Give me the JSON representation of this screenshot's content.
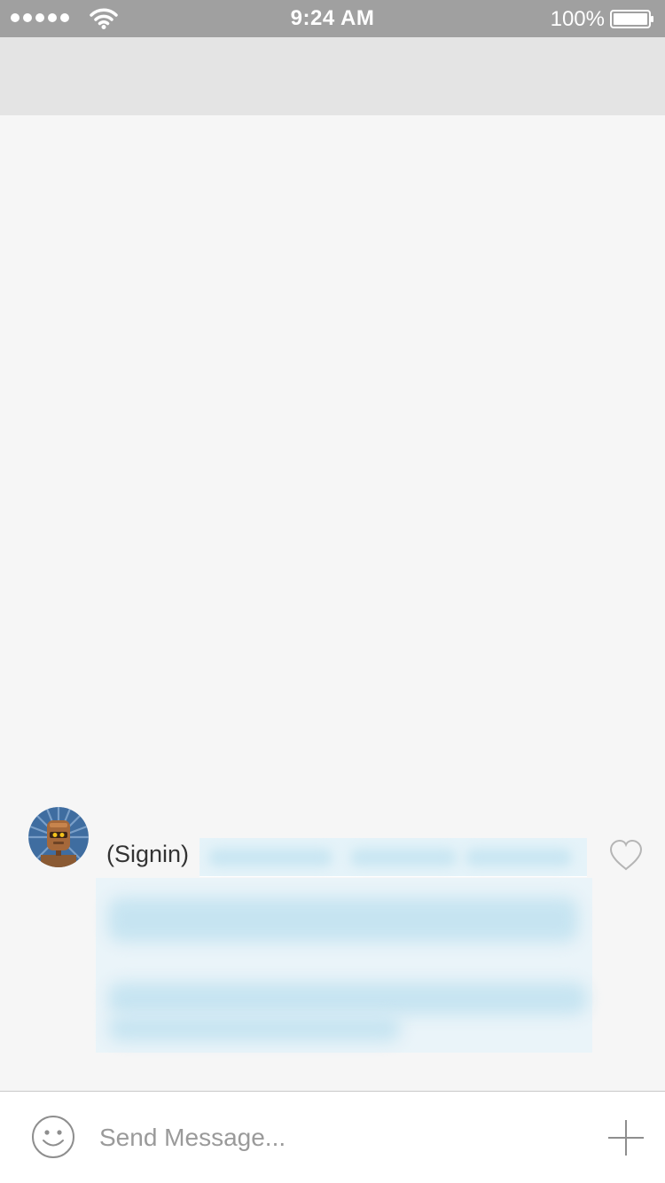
{
  "status_bar": {
    "time": "9:24 AM",
    "battery_percent": "100%",
    "signal_bars": 5,
    "wifi_icon": "wifi-icon",
    "battery_icon": "battery-full-icon"
  },
  "nav_bar": {
    "title": ""
  },
  "messages": [
    {
      "sender": "(Signin)",
      "avatar_icon": "robot-avatar-icon",
      "like_icon": "heart-outline-icon"
    }
  ],
  "composer": {
    "placeholder": "Send Message...",
    "emoji_icon": "smiley-icon",
    "add_icon": "plus-icon"
  },
  "colors": {
    "status_bar": "#a0a0a0",
    "nav_bar": "#e4e4e4",
    "background": "#f6f6f6",
    "redaction": "#c6e4f1"
  }
}
